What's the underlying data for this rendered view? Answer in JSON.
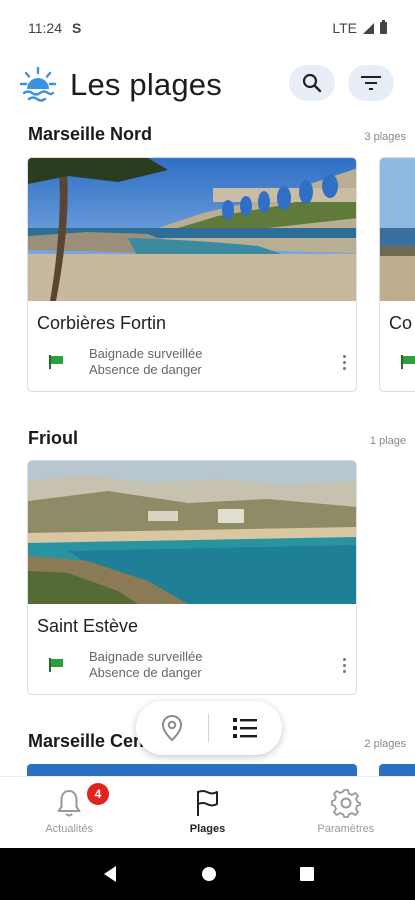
{
  "status_bar": {
    "time": "11:24",
    "sim_icon": "S",
    "network": "LTE"
  },
  "header": {
    "title": "Les plages",
    "logo_icon": "sun-water-icon",
    "search_icon": "search-icon",
    "filter_icon": "filter-icon"
  },
  "sections": [
    {
      "name": "Marseille Nord",
      "count": "3 plages",
      "cards": [
        {
          "name": "Corbières Fortin",
          "status_line1": "Baignade surveillée",
          "status_line2": "Absence de danger",
          "flag_color": "#2e9e3f"
        },
        {
          "name": "Co",
          "flag_color": "#2e9e3f"
        }
      ]
    },
    {
      "name": "Frioul",
      "count": "1 plage",
      "cards": [
        {
          "name": "Saint Estève",
          "status_line1": "Baignade surveillée",
          "status_line2": "Absence de danger",
          "flag_color": "#2e9e3f"
        }
      ]
    },
    {
      "name": "Marseille Cen",
      "count": "2 plages"
    }
  ],
  "view_toggle": {
    "map_icon": "map-pin-icon",
    "list_icon": "list-icon"
  },
  "bottom_nav": {
    "items": [
      {
        "label": "Actualités",
        "icon": "bell-icon",
        "badge": "4"
      },
      {
        "label": "Plages",
        "icon": "flag-icon",
        "active": true
      },
      {
        "label": "Paramètres",
        "icon": "gear-icon"
      }
    ]
  },
  "colors": {
    "accent": "#2b7fd9",
    "flag_green": "#2e9e3f",
    "badge_red": "#e0231e",
    "button_bg": "#e8eef8"
  }
}
